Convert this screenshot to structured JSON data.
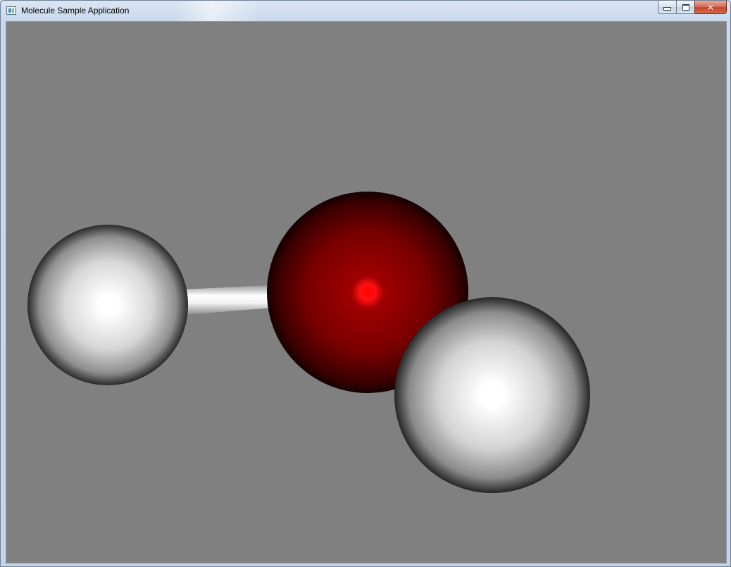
{
  "window": {
    "title": "Molecule Sample Application",
    "icon": "app-window-icon",
    "controls": {
      "minimize_icon": "minimize-icon",
      "maximize_icon": "restore-icon",
      "close_icon": "close-icon",
      "close_glyph": "✕"
    }
  },
  "scene": {
    "background_color": "#808080",
    "atoms": [
      {
        "element": "H",
        "color": "#ffffff"
      },
      {
        "element": "O",
        "color": "#8b0000"
      },
      {
        "element": "H",
        "color": "#ffffff"
      }
    ],
    "bonds": [
      {
        "from": 0,
        "to": 1,
        "color": "#e6e6e6"
      },
      {
        "from": 1,
        "to": 2,
        "color": "#7a7a7a"
      }
    ]
  }
}
